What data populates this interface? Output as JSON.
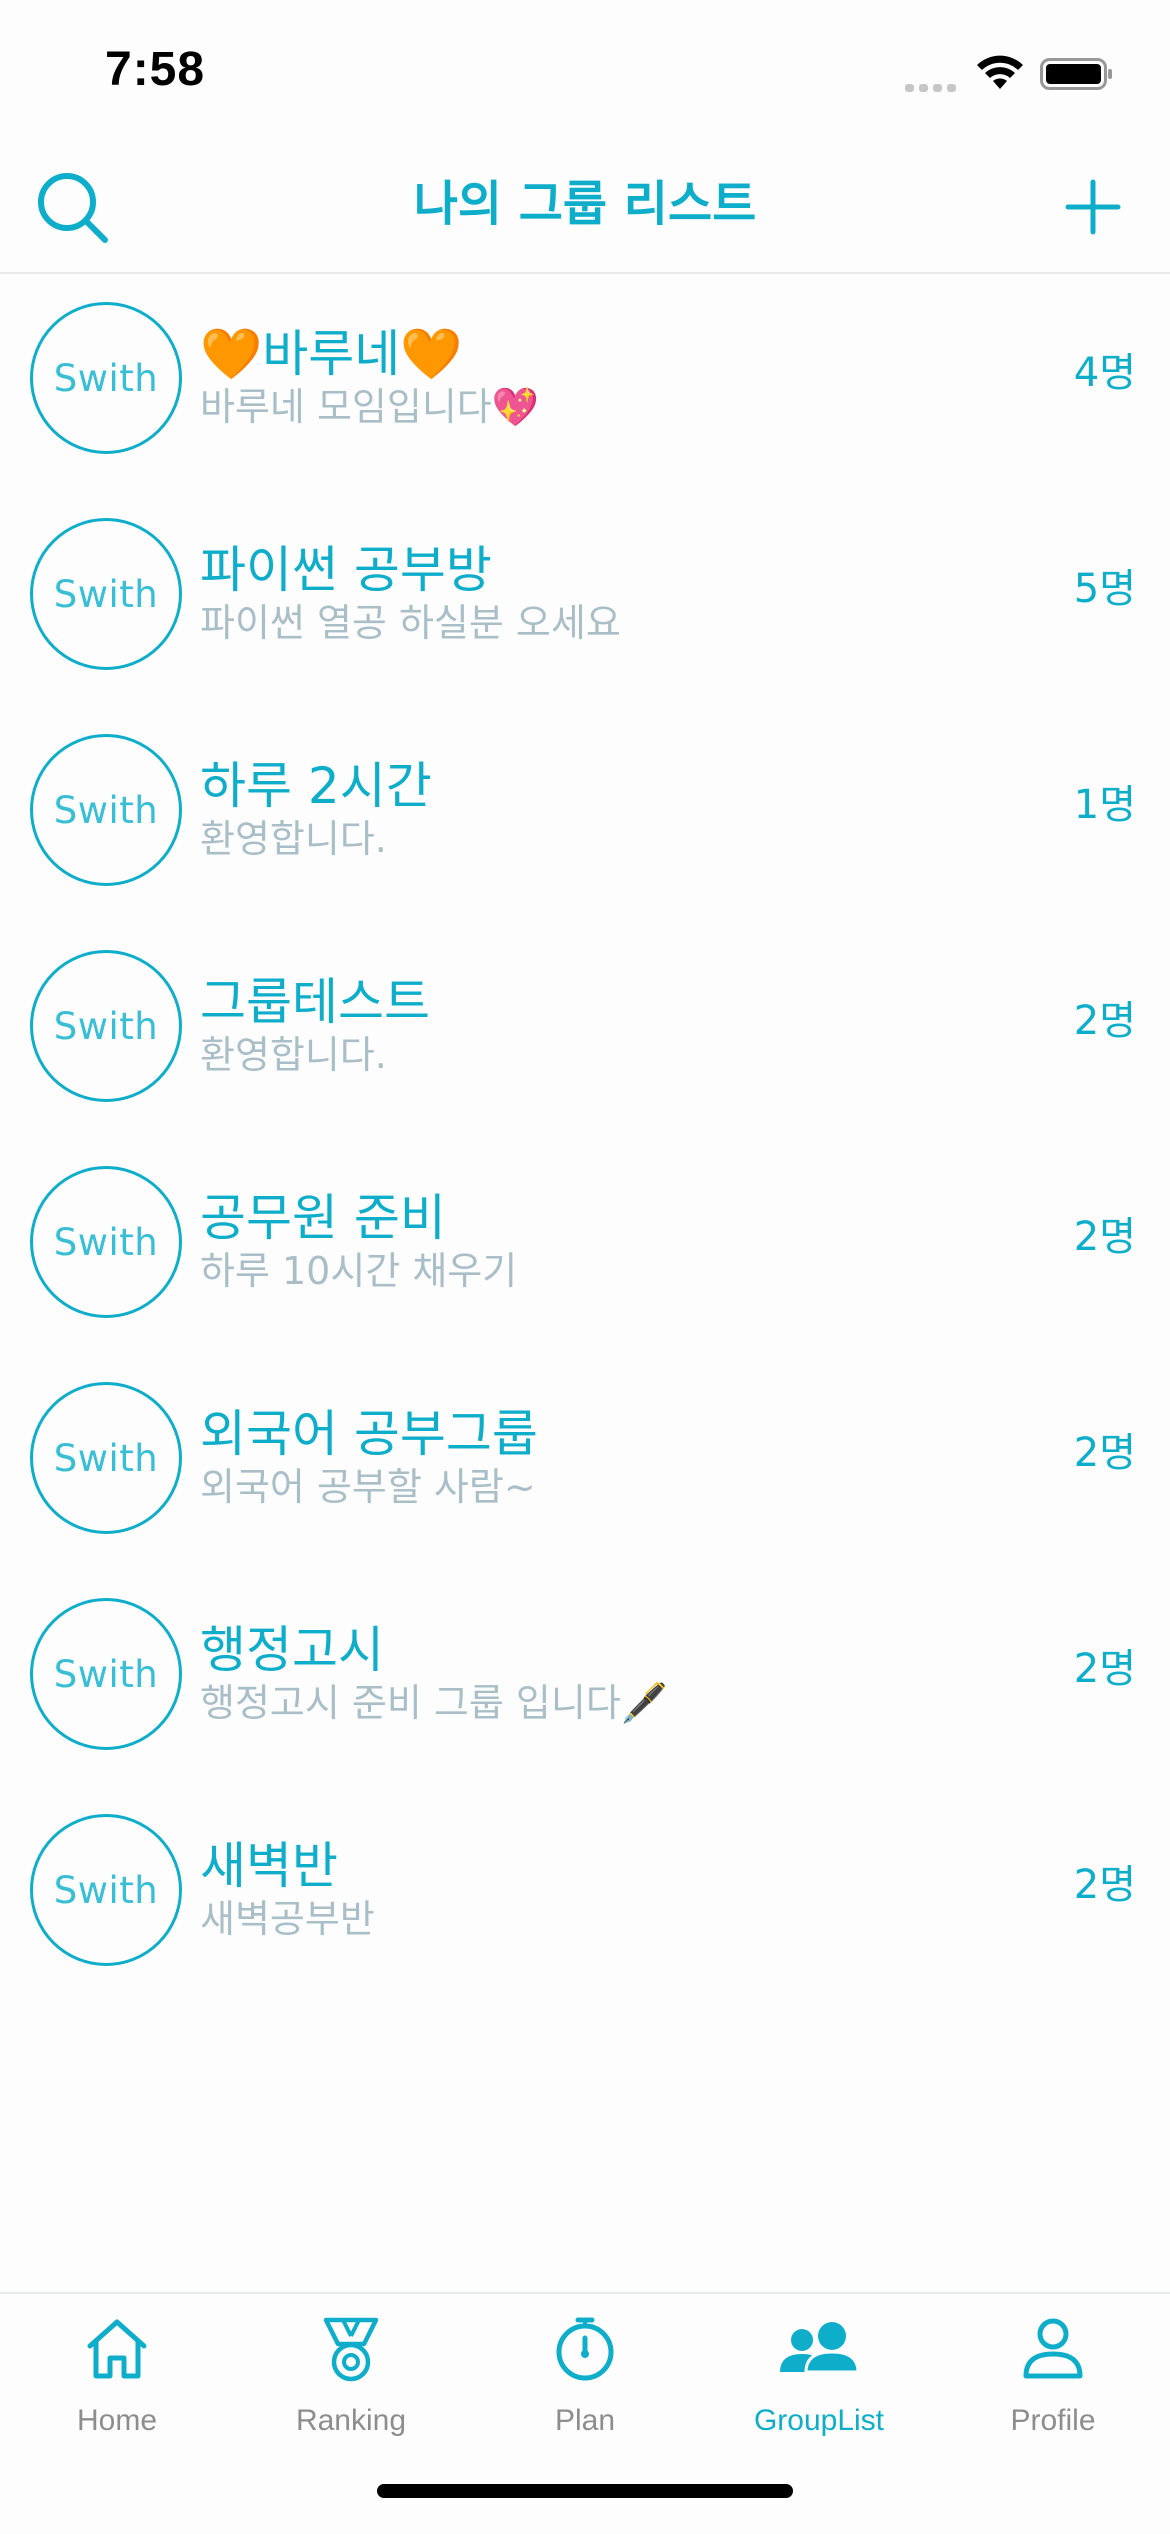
{
  "status": {
    "time": "7:58"
  },
  "header": {
    "title": "나의 그룹 리스트"
  },
  "avatar_label": "Swith",
  "groups": [
    {
      "name": "🧡바루네🧡",
      "description": "바루네 모임입니다💖",
      "count": "4명"
    },
    {
      "name": "파이썬 공부방",
      "description": "파이썬 열공 하실분 오세요",
      "count": "5명"
    },
    {
      "name": "하루 2시간",
      "description": "환영합니다.",
      "count": "1명"
    },
    {
      "name": "그룹테스트",
      "description": "환영합니다.",
      "count": "2명"
    },
    {
      "name": "공무원 준비",
      "description": "하루 10시간 채우기",
      "count": "2명"
    },
    {
      "name": "외국어 공부그룹",
      "description": "외국어 공부할 사람~",
      "count": "2명"
    },
    {
      "name": "행정고시",
      "description": "행정고시 준비 그룹 입니다🖋️",
      "count": "2명"
    },
    {
      "name": "새벽반",
      "description": "새벽공부반",
      "count": "2명"
    }
  ],
  "tabs": [
    {
      "label": "Home",
      "icon": "home-icon",
      "active": false
    },
    {
      "label": "Ranking",
      "icon": "medal-icon",
      "active": false
    },
    {
      "label": "Plan",
      "icon": "timer-icon",
      "active": false
    },
    {
      "label": "GroupList",
      "icon": "people-icon",
      "active": true
    },
    {
      "label": "Profile",
      "icon": "person-icon",
      "active": false
    }
  ],
  "colors": {
    "accent": "#0eaecb",
    "inactive": "#8d8d8d",
    "description": "#a9bec7"
  }
}
